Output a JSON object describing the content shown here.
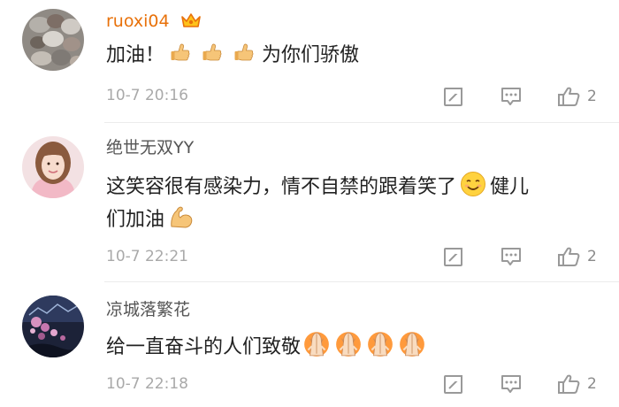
{
  "colors": {
    "vip_name": "#e8710a",
    "name": "#555555",
    "text": "#222222",
    "meta": "#a9a9a9",
    "icon": "#999999"
  },
  "comments": [
    {
      "username": "ruoxi04",
      "badge_icon": "crown-icon",
      "text_before": "加油！",
      "text_after": "为你们骄傲",
      "emoji_icons": [
        "thumbs-up-emoji",
        "thumbs-up-emoji",
        "thumbs-up-emoji"
      ],
      "timestamp": "10-7 20:16",
      "like_count": "2"
    },
    {
      "username": "绝世无双YY",
      "text_line1": "这笑容很有感染力，情不自禁的跟着笑了",
      "text_line1_tail": "健儿",
      "text_line2": "们加油",
      "emoji_icons": [
        "smiling-face-emoji",
        "flexed-biceps-emoji"
      ],
      "timestamp": "10-7 22:21",
      "like_count": "2"
    },
    {
      "username": "凉城落繁花",
      "text": "给一直奋斗的人们致敬",
      "emoji_icons": [
        "folded-hands-emoji",
        "folded-hands-emoji",
        "folded-hands-emoji",
        "folded-hands-emoji"
      ],
      "timestamp": "10-7 22:18",
      "like_count": "2"
    }
  ],
  "action_icons": [
    "share-icon",
    "reply-icon",
    "like-icon"
  ]
}
